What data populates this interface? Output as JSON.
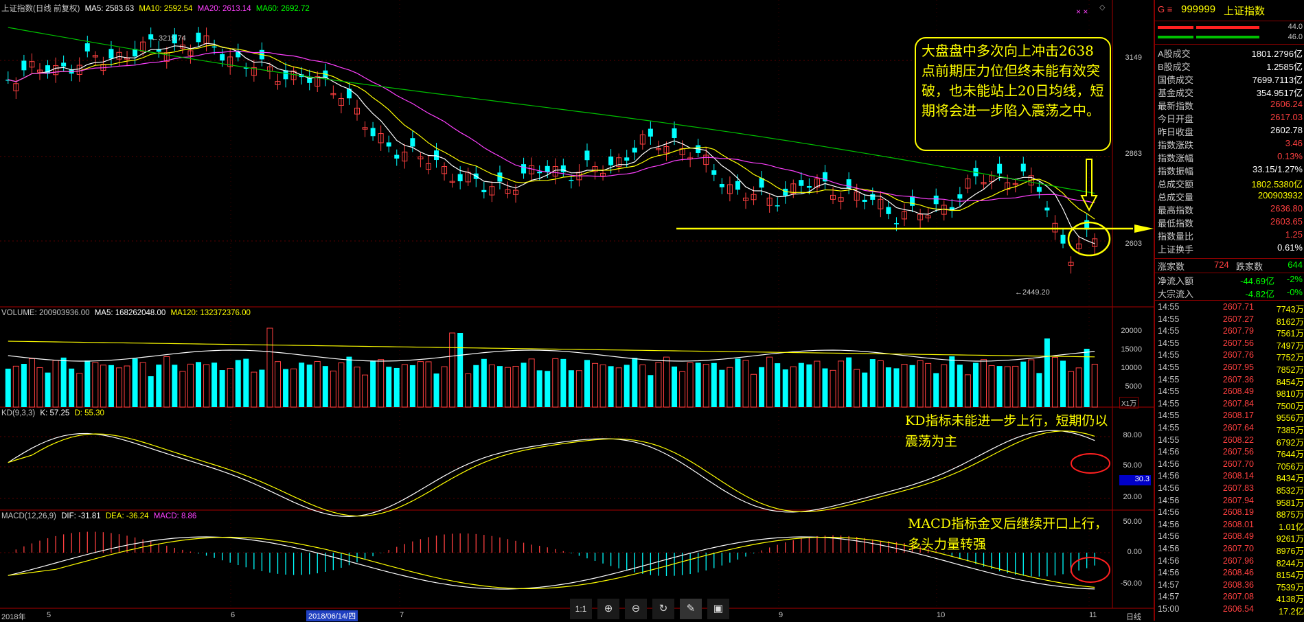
{
  "header": {
    "title": "上证指数(日线 前复权)",
    "ma5": "MA5: 2583.63",
    "ma10": "MA10: 2592.54",
    "ma20": "MA20: 2613.14",
    "ma60": "MA60: 2692.72"
  },
  "price_axis": [
    "3149",
    "2863",
    "2603"
  ],
  "high_label": "3219.74",
  "low_label": "2449.20",
  "annotation_box": "大盘盘中多次向上冲击2638点前期压力位但终未能有效突破，也未能站上20日均线，短期将会进一步陷入震荡之中。",
  "volume": {
    "header": "VOLUME: 200903936.00",
    "ma5": "MA5: 168262048.00",
    "ma120": "MA120: 132372376.00",
    "axis": [
      "20000",
      "15000",
      "10000",
      "5000"
    ],
    "unit": "X1万"
  },
  "kd": {
    "header": "KD(9,3,3)",
    "k": "K: 57.25",
    "d": "D: 55.30",
    "axis": [
      "80.00",
      "50.00",
      "20.00"
    ],
    "marker": "30.3",
    "annotation": "KD指标未能进一步上行，短期仍以震荡为主"
  },
  "macd": {
    "header": "MACD(12,26,9)",
    "dif": "DIF: -31.81",
    "dea": "DEA: -36.24",
    "macd": "MACD: 8.86",
    "axis": [
      "50.00",
      "0.00",
      "-50.00"
    ],
    "annotation": "MACD指标金叉后继续开口上行，多头力量转强"
  },
  "x_axis": {
    "year": "2018年",
    "months": [
      "5",
      "6",
      "7",
      "9",
      "10",
      "11"
    ],
    "cursor_date": "2018/06/14/四",
    "period": "日线"
  },
  "toolbar": [
    "1:1",
    "zoom-in",
    "zoom-out",
    "refresh",
    "clear",
    "save"
  ],
  "panel": {
    "code": "999999",
    "name": "上证指数",
    "bar_values": [
      "44.0",
      "46.0"
    ],
    "stats": [
      {
        "label": "A股成交",
        "value": "1801.2796亿",
        "color": "#ffffff"
      },
      {
        "label": "B股成交",
        "value": "1.2585亿",
        "color": "#ffffff"
      },
      {
        "label": "国债成交",
        "value": "7699.7113亿",
        "color": "#ffffff"
      },
      {
        "label": "基金成交",
        "value": "354.9517亿",
        "color": "#ffffff"
      },
      {
        "label": "最新指数",
        "value": "2606.24",
        "color": "#ff4040"
      },
      {
        "label": "今日开盘",
        "value": "2617.03",
        "color": "#ff4040"
      },
      {
        "label": "昨日收盘",
        "value": "2602.78",
        "color": "#ffffff"
      },
      {
        "label": "指数涨跌",
        "value": "3.46",
        "color": "#ff4040"
      },
      {
        "label": "指数涨幅",
        "value": "0.13%",
        "color": "#ff4040"
      },
      {
        "label": "指数振幅",
        "value": "33.15/1.27%",
        "color": "#ffffff"
      },
      {
        "label": "总成交额",
        "value": "1802.5380亿",
        "color": "#ffff00"
      },
      {
        "label": "总成交量",
        "value": "200903932",
        "color": "#ffff00"
      },
      {
        "label": "最高指数",
        "value": "2636.80",
        "color": "#ff4040"
      },
      {
        "label": "最低指数",
        "value": "2603.65",
        "color": "#ff4040"
      },
      {
        "label": "指数量比",
        "value": "1.25",
        "color": "#ff4040"
      },
      {
        "label": "上证换手",
        "value": "0.61%",
        "color": "#ffffff"
      }
    ],
    "rise_label": "涨家数",
    "rise_value": "724",
    "fall_label": "跌家数",
    "fall_value": "644",
    "flows": [
      {
        "label": "净流入额",
        "value": "-44.69亿",
        "pct": "-2%"
      },
      {
        "label": "大宗流入",
        "value": "-4.82亿",
        "pct": "-0%"
      }
    ],
    "ticks": [
      [
        "14:55",
        "2607.71",
        "7743万"
      ],
      [
        "14:55",
        "2607.27",
        "8162万"
      ],
      [
        "14:55",
        "2607.79",
        "7561万"
      ],
      [
        "14:55",
        "2607.56",
        "7497万"
      ],
      [
        "14:55",
        "2607.76",
        "7752万"
      ],
      [
        "14:55",
        "2607.95",
        "7852万"
      ],
      [
        "14:55",
        "2607.36",
        "8454万"
      ],
      [
        "14:55",
        "2608.49",
        "9810万"
      ],
      [
        "14:55",
        "2607.84",
        "7500万"
      ],
      [
        "14:55",
        "2608.17",
        "9556万"
      ],
      [
        "14:55",
        "2607.64",
        "7385万"
      ],
      [
        "14:55",
        "2608.22",
        "6792万"
      ],
      [
        "14:56",
        "2607.56",
        "7644万"
      ],
      [
        "14:56",
        "2607.70",
        "7056万"
      ],
      [
        "14:56",
        "2608.14",
        "8434万"
      ],
      [
        "14:56",
        "2607.83",
        "8532万"
      ],
      [
        "14:56",
        "2607.94",
        "9581万"
      ],
      [
        "14:56",
        "2608.19",
        "8875万"
      ],
      [
        "14:56",
        "2608.01",
        "1.01亿"
      ],
      [
        "14:56",
        "2608.49",
        "9261万"
      ],
      [
        "14:56",
        "2607.70",
        "8976万"
      ],
      [
        "14:56",
        "2607.96",
        "8244万"
      ],
      [
        "14:56",
        "2608.46",
        "8154万"
      ],
      [
        "14:57",
        "2608.36",
        "7539万"
      ],
      [
        "14:57",
        "2607.08",
        "4138万"
      ],
      [
        "15:00",
        "2606.54",
        "17.2亿"
      ]
    ]
  }
}
